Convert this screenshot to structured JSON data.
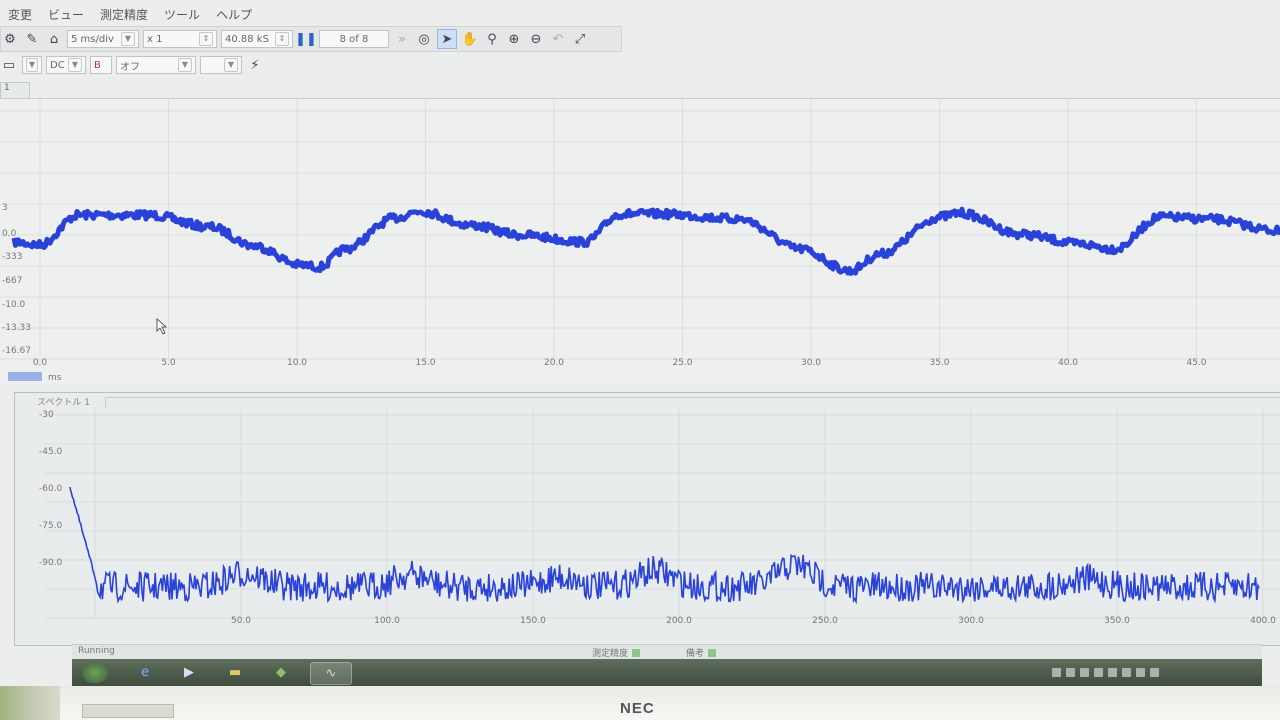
{
  "menubar": [
    "変更",
    "ビュー",
    "測定精度",
    "ツール",
    "ヘルプ"
  ],
  "toolbar": {
    "timebase": "5 ms/div",
    "zoom": "x 1",
    "samples": "40.88 kS",
    "buffer": "8 of 8"
  },
  "channel": {
    "coupling": "DC",
    "channel_label": "B",
    "state": "オフ"
  },
  "scope": {
    "tab_label": "1",
    "unit_label": "ms",
    "x_ticks": [
      "0.0",
      "5.0",
      "10.0",
      "15.0",
      "20.0",
      "25.0",
      "30.0",
      "35.0",
      "40.0",
      "45.0"
    ],
    "y_ticks": [
      "3",
      "0.0",
      "-333",
      "-667",
      "-10.0",
      "-13.33",
      "-16.67"
    ],
    "trace_color": "#2a42d8"
  },
  "spectrum": {
    "title": "スペクトル 1",
    "y_ticks": [
      "-30",
      "-45.0",
      "-60.0",
      "-75.0",
      "-90.0"
    ],
    "x_ticks": [
      "50.0",
      "100.0",
      "150.0",
      "200.0",
      "250.0",
      "300.0",
      "350.0",
      "400.0"
    ]
  },
  "statusbar": {
    "left": "Running",
    "measure": "測定精度",
    "notes": "備考"
  },
  "brand": "NEC"
}
